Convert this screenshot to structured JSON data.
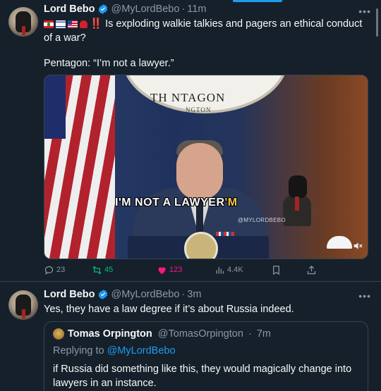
{
  "tweet1": {
    "author_name": "Lord Bebo",
    "handle": "@MyLordBebo",
    "separator": "·",
    "time": "11m",
    "more_label": "•••",
    "flags": [
      "flag-lebanon",
      "flag-israel",
      "flag-usa",
      "flag-red-light"
    ],
    "exclaim": "‼️",
    "text_line1": "Is exploding walkie talkies and pagers an ethical conduct of a war?",
    "text_line2": "Pentagon:  “I’m not a lawyer.”",
    "media": {
      "seal_text": "TH    NTAGON",
      "seal_sub": "NGTON",
      "caption_main": "I'M NOT A LAWYER",
      "caption_tail": "'M",
      "watermark": "@MYLORDBEBO"
    },
    "actions": {
      "replies": "23",
      "retweets": "45",
      "likes": "123",
      "views": "4.4K"
    }
  },
  "tweet2": {
    "author_name": "Lord Bebo",
    "handle": "@MyLordBebo",
    "separator": "·",
    "time": "3m",
    "more_label": "•••",
    "text": "Yes, they have a law degree if it’s about Russia indeed.",
    "quote": {
      "author_name": "Tomas Orpington",
      "handle": "@TomasOrpington",
      "separator": "·",
      "time": "7m",
      "replying_label": "Replying to",
      "replying_mention": "@MyLordBebo",
      "text": "if Russia did something like this, they would magically change into lawyers in an instance."
    }
  },
  "colors": {
    "background": "#15202b",
    "accent": "#1d9bf0",
    "retweet": "#00ba7c",
    "like": "#f91880",
    "muted": "#8b98a5"
  }
}
